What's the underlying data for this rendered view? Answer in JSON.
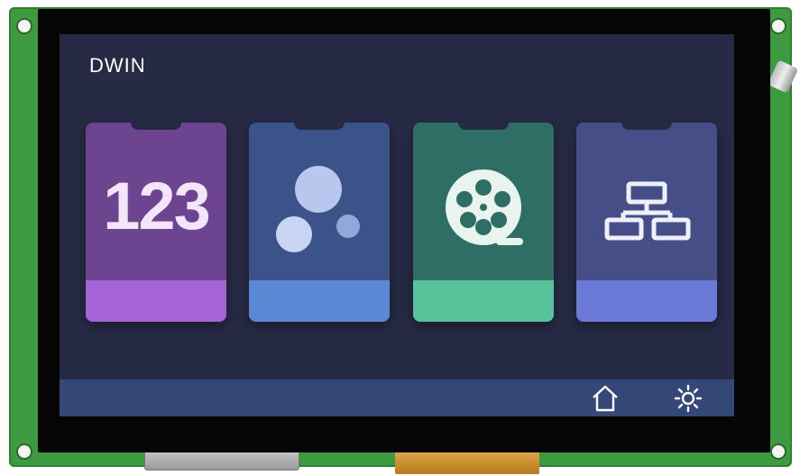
{
  "brand": {
    "label": "DWIN"
  },
  "tiles": [
    {
      "name": "numbers",
      "icon": "numeric-123-icon",
      "glyph": "123",
      "body_color": "#6c448f",
      "footer_color": "#a463d6"
    },
    {
      "name": "circles",
      "icon": "circles-icon",
      "body_color": "#3b5388",
      "footer_color": "#5b87d4"
    },
    {
      "name": "video",
      "icon": "film-reel-icon",
      "body_color": "#2f6e64",
      "footer_color": "#58c29b"
    },
    {
      "name": "network",
      "icon": "network-hierarchy-icon",
      "body_color": "#464e87",
      "footer_color": "#6b79d8"
    }
  ],
  "bottom_bar": {
    "buttons": [
      {
        "name": "home",
        "icon": "home-icon"
      },
      {
        "name": "settings",
        "icon": "gear-icon"
      }
    ]
  }
}
